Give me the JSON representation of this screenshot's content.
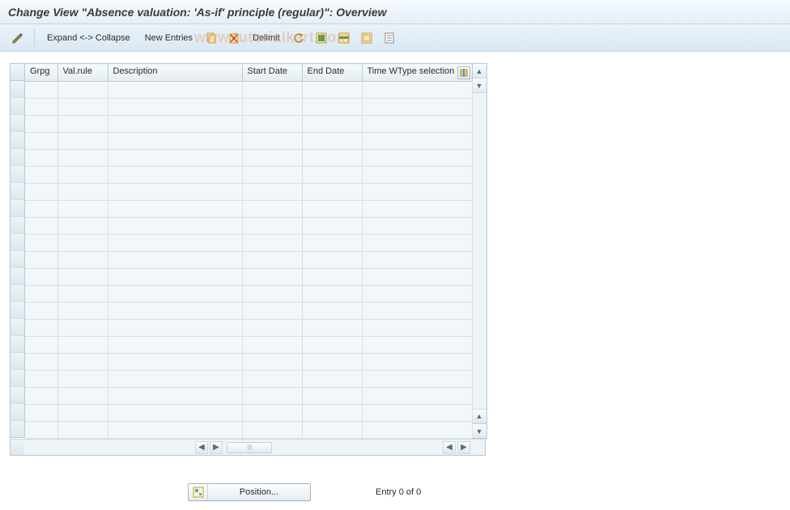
{
  "title": "Change View \"Absence valuation: 'As-if' principle (regular)\": Overview",
  "watermark": "www.tutorialkart.com",
  "toolbar": {
    "expand_collapse": "Expand <-> Collapse",
    "new_entries": "New Entries",
    "delimit": "Delimit",
    "icons": {
      "pencil": "toggle-change-icon",
      "copy": "copy-as-icon",
      "delete": "delete-icon",
      "undo": "undo-change-icon",
      "select_all": "select-all-icon",
      "select_block": "select-block-icon",
      "deselect_all": "deselect-all-icon",
      "print": "print-icon"
    }
  },
  "columns": [
    {
      "key": "grpg",
      "label": "Grpg",
      "width": 40
    },
    {
      "key": "valrule",
      "label": "Val.rule",
      "width": 62
    },
    {
      "key": "description",
      "label": "Description",
      "width": 166
    },
    {
      "key": "start_date",
      "label": "Start Date",
      "width": 74
    },
    {
      "key": "end_date",
      "label": "End Date",
      "width": 74
    },
    {
      "key": "time_wtype",
      "label": "Time WType selection",
      "width": 136
    }
  ],
  "row_count": 21,
  "rows": [],
  "footer": {
    "position_button": "Position...",
    "entry_text": "Entry 0 of 0"
  }
}
